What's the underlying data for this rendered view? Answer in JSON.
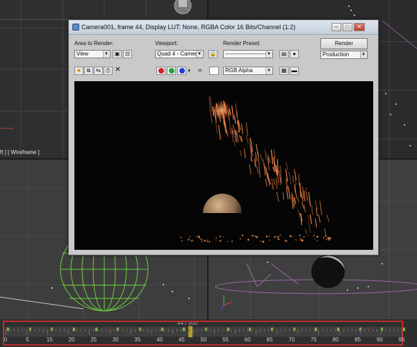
{
  "window": {
    "title": "Camera001, frame 44, Display LUT: None, RGBA Color 16 Bits/Channel (1:2)",
    "minimize": "–",
    "maximize": "□",
    "close": "✕"
  },
  "controls": {
    "area_label": "Area to Render:",
    "area_value": "View",
    "viewport_label": "Viewport:",
    "viewport_value": "Quad 4 - Cameral",
    "preset_label": "Render Preset:",
    "preset_value": "--------------------------",
    "render_button": "Render",
    "production_value": "Production",
    "channel_value": "RGB Alpha",
    "delete_icon": "✕"
  },
  "viewport": {
    "label": "ft ] [ Wireframe ]"
  },
  "timeline": {
    "frame_counter": "44 / 100",
    "ticks": [
      "0",
      "5",
      "15",
      "20",
      "25",
      "30",
      "35",
      "40",
      "45",
      "50",
      "55",
      "60",
      "65",
      "70",
      "75",
      "80",
      "85",
      "90",
      "95"
    ]
  },
  "colors": {
    "accent_red": "#c42b2b",
    "slider": "#b79a2c",
    "sparks": "#ff8a4a",
    "wire_green": "#6fd13c"
  }
}
